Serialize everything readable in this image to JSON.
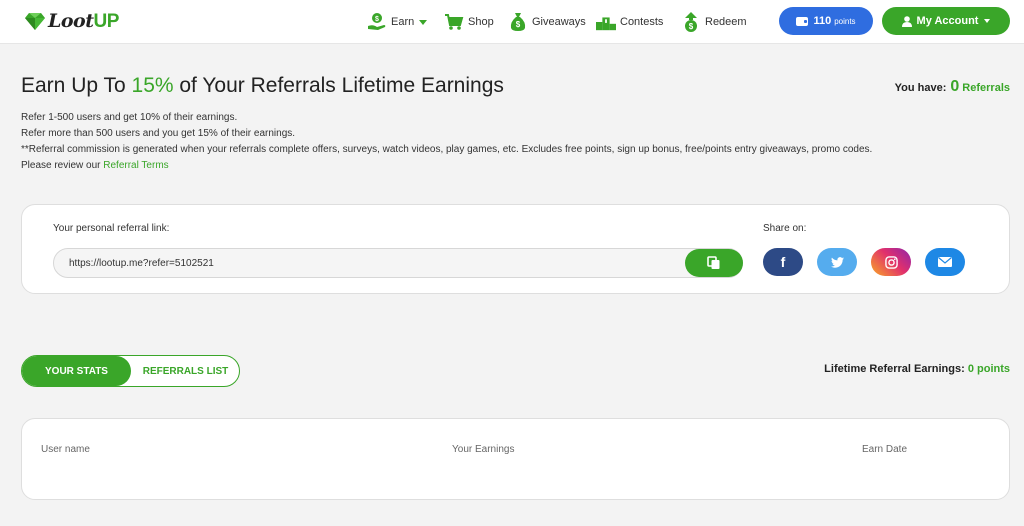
{
  "brand": {
    "logo_main": "Loot",
    "logo_accent": "UP",
    "accent_color": "#3aa629",
    "blue_color": "#2f6de0"
  },
  "nav": {
    "items": [
      {
        "label": "Earn",
        "icon": "hand-money-icon"
      },
      {
        "label": "Shop",
        "icon": "cart-icon"
      },
      {
        "label": "Giveaways",
        "icon": "money-bag-icon"
      },
      {
        "label": "Contests",
        "icon": "podium-icon"
      },
      {
        "label": "Redeem",
        "icon": "redeem-icon"
      }
    ],
    "points_value": "110",
    "points_unit": "points",
    "account_label": "My Account"
  },
  "heading": {
    "prefix": "Earn Up To ",
    "percent": "15%",
    "suffix": " of Your Referrals Lifetime Earnings",
    "you_have_label": "You have:",
    "referral_count": "0",
    "referrals_label": "Referrals"
  },
  "description": {
    "line1": "Refer 1-500 users and get 10% of their earnings.",
    "line2": "Refer more than 500 users and you get 15% of their earnings.",
    "line3": "**Referral commission is generated when your referrals complete offers, surveys, watch videos, play games, etc. Excludes free points, sign up bonus, free/points entry giveaways, promo codes.",
    "line4_prefix": "Please review our ",
    "line4_link": "Referral Terms"
  },
  "referral": {
    "link_label": "Your personal referral link:",
    "link_value": "https://lootup.me?refer=5102521",
    "share_label": "Share on:",
    "share_buttons": [
      {
        "name": "facebook",
        "icon": "facebook-icon",
        "color": "#2d4a86"
      },
      {
        "name": "twitter",
        "icon": "twitter-icon",
        "color": "#55acee"
      },
      {
        "name": "instagram",
        "icon": "instagram-icon",
        "color": "#e1306c"
      },
      {
        "name": "email",
        "icon": "email-icon",
        "color": "#1e88e5"
      }
    ]
  },
  "tabs": {
    "stats": "YOUR STATS",
    "list": "REFERRALS LIST",
    "active": "stats"
  },
  "lifetime": {
    "label": "Lifetime Referral Earnings:",
    "value": "0 points"
  },
  "table": {
    "columns": [
      "User name",
      "Your Earnings",
      "Earn Date"
    ],
    "rows": []
  }
}
